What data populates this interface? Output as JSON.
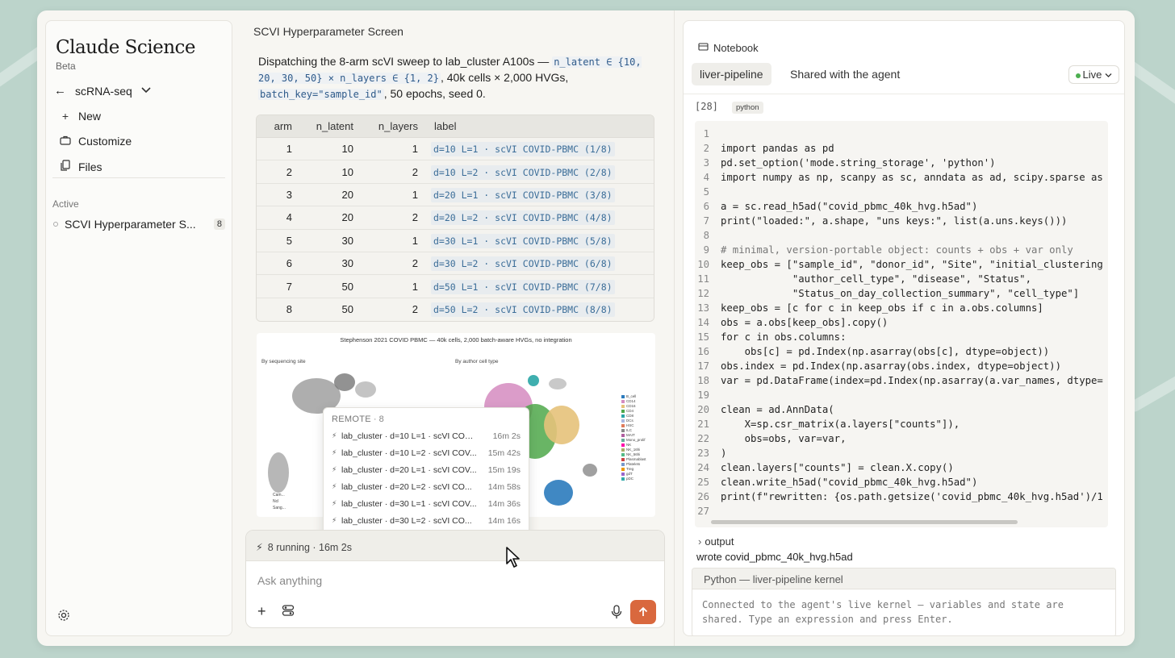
{
  "sidebar": {
    "brand": "Claude Science",
    "beta": "Beta",
    "project": "scRNA-seq",
    "nav": [
      {
        "label": "New",
        "icon": "plus-icon"
      },
      {
        "label": "Customize",
        "icon": "briefcase-icon"
      },
      {
        "label": "Files",
        "icon": "files-icon"
      }
    ],
    "active_label": "Active",
    "active_item": {
      "title": "SCVI Hyperparameter S...",
      "count": "8"
    }
  },
  "chat": {
    "title": "SCVI Hyperparameter Screen",
    "message": {
      "p1": "Dispatching the 8-arm scVI sweep to lab_cluster A100s — ",
      "c1": "n_latent ∈ {10, 20, 30, 50} × n_layers ∈ {1, 2}",
      "p2": ", 40k cells × 2,000 HVGs, ",
      "c2": "batch_key=\"sample_id\"",
      "p3": ", 50 epochs, seed 0."
    },
    "table": {
      "headers": [
        "arm",
        "n_latent",
        "n_layers",
        "label"
      ],
      "rows": [
        [
          "1",
          "10",
          "1",
          "d=10 L=1 · scVI COVID-PBMC (1/8)"
        ],
        [
          "2",
          "10",
          "2",
          "d=10 L=2 · scVI COVID-PBMC (2/8)"
        ],
        [
          "3",
          "20",
          "1",
          "d=20 L=1 · scVI COVID-PBMC (3/8)"
        ],
        [
          "4",
          "20",
          "2",
          "d=20 L=2 · scVI COVID-PBMC (4/8)"
        ],
        [
          "5",
          "30",
          "1",
          "d=30 L=1 · scVI COVID-PBMC (5/8)"
        ],
        [
          "6",
          "30",
          "2",
          "d=30 L=2 · scVI COVID-PBMC (6/8)"
        ],
        [
          "7",
          "50",
          "1",
          "d=50 L=1 · scVI COVID-PBMC (7/8)"
        ],
        [
          "8",
          "50",
          "2",
          "d=50 L=2 · scVI COVID-PBMC (8/8)"
        ]
      ]
    },
    "figure": {
      "title": "Stephenson 2021 COVID PBMC — 40k cells, 2,000 batch-aware HVGs, no integration",
      "panel1": "By sequencing site",
      "panel2": "By author cell type",
      "legend": [
        "B_cell",
        "CD14",
        "CD16",
        "CD4",
        "CD8",
        "DCs",
        "HSC",
        "ILC",
        "MAIT",
        "Mono_prolif",
        "NK",
        "NK_16hi",
        "NK_56hi",
        "Plasmablast",
        "Platelets",
        "Treg",
        "gdT",
        "pDC"
      ],
      "left_legend": [
        "Cam...",
        "Ncl",
        "Sang..."
      ]
    },
    "remote": {
      "head_label": "REMOTE",
      "head_count": "8",
      "rows": [
        {
          "label": "lab_cluster · d=10 L=1 · scVI COVI...",
          "time": "16m 2s"
        },
        {
          "label": "lab_cluster · d=10 L=2 · scVI COV...",
          "time": "15m 42s"
        },
        {
          "label": "lab_cluster · d=20 L=1 · scVI COV...",
          "time": "15m 19s"
        },
        {
          "label": "lab_cluster · d=20 L=2 · scVI CO...",
          "time": "14m 58s"
        },
        {
          "label": "lab_cluster · d=30 L=1 · scVI COV...",
          "time": "14m 36s"
        },
        {
          "label": "lab_cluster · d=30 L=2 · scVI CO...",
          "time": "14m 16s"
        }
      ]
    },
    "running": "8 running · 16m 2s",
    "input_placeholder": "Ask anything"
  },
  "notebook": {
    "header": "Notebook",
    "tabs": [
      "liver-pipeline",
      "Shared with the agent"
    ],
    "live": "Live",
    "cell_number": "[28]",
    "lang": "python",
    "code": [
      "",
      "import pandas as pd",
      "pd.set_option('mode.string_storage', 'python')",
      "import numpy as np, scanpy as sc, anndata as ad, scipy.sparse as",
      "",
      "a = sc.read_h5ad(\"covid_pbmc_40k_hvg.h5ad\")",
      "print(\"loaded:\", a.shape, \"uns keys:\", list(a.uns.keys()))",
      "",
      "# minimal, version-portable object: counts + obs + var only",
      "keep_obs = [\"sample_id\", \"donor_id\", \"Site\", \"initial_clustering",
      "            \"author_cell_type\", \"disease\", \"Status\",",
      "            \"Status_on_day_collection_summary\", \"cell_type\"]",
      "keep_obs = [c for c in keep_obs if c in a.obs.columns]",
      "obs = a.obs[keep_obs].copy()",
      "for c in obs.columns:",
      "    obs[c] = pd.Index(np.asarray(obs[c], dtype=object))",
      "obs.index = pd.Index(np.asarray(obs.index, dtype=object))",
      "var = pd.DataFrame(index=pd.Index(np.asarray(a.var_names, dtype=",
      "",
      "clean = ad.AnnData(",
      "    X=sp.csr_matrix(a.layers[\"counts\"]),",
      "    obs=obs, var=var,",
      ")",
      "clean.layers[\"counts\"] = clean.X.copy()",
      "clean.write_h5ad(\"covid_pbmc_40k_hvg.h5ad\")",
      "print(f\"rewritten: {os.path.getsize('covid_pbmc_40k_hvg.h5ad')/1",
      ""
    ],
    "output_label": "output",
    "output_text": "wrote covid_pbmc_40k_hvg.h5ad",
    "kernel_title": "Python — liver-pipeline kernel",
    "kernel_body": "Connected to the agent's live kernel — variables and state are shared. Type an expression and press Enter."
  }
}
